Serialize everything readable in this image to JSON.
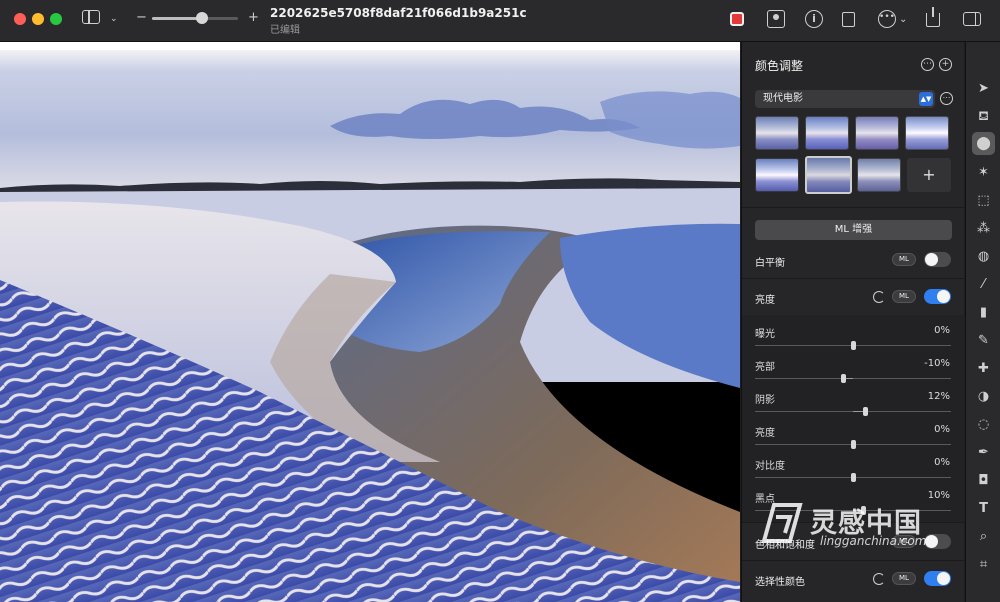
{
  "window": {
    "title": "2202625e5708f8daf21f066d1b9a251c",
    "subtitle": "已编辑",
    "zoom_minus": "−",
    "zoom_plus": "+",
    "zoom_level_fraction": 0.58
  },
  "toolbar_icons": [
    "sidebar-icon",
    "chevron-down-icon",
    "color-badge-icon",
    "portrait-icon",
    "info-icon",
    "rotate-icon",
    "more-icon",
    "share-icon",
    "inspector-icon"
  ],
  "panel": {
    "title": "颜色调整",
    "header_more": "⋯",
    "header_add": "+",
    "preset": {
      "selected": "现代电影",
      "more": "⋯"
    },
    "thumb_add": "+",
    "ml_enhance_label": "ML 增强",
    "white_balance": {
      "label": "白平衡",
      "ml": "ML",
      "enabled": false
    },
    "lightness": {
      "label": "亮度",
      "ml": "ML",
      "enabled": true,
      "sliders": [
        {
          "label": "曝光",
          "value_text": "0%",
          "value": 0
        },
        {
          "label": "亮部",
          "value_text": "-10%",
          "value": -10
        },
        {
          "label": "阴影",
          "value_text": "12%",
          "value": 12
        },
        {
          "label": "亮度",
          "value_text": "0%",
          "value": 0
        },
        {
          "label": "对比度",
          "value_text": "0%",
          "value": 0
        },
        {
          "label": "黑点",
          "value_text": "10%",
          "value": 10
        }
      ]
    },
    "hue_saturation": {
      "label": "色相和饱和度",
      "ml": "ML",
      "enabled": false
    },
    "selective_color": {
      "label": "选择性颜色",
      "ml": "ML",
      "enabled": true
    }
  },
  "tools": [
    "arrow-icon",
    "paint-bucket-icon",
    "color-adjust-icon",
    "magic-star-icon",
    "marquee-icon",
    "magic-wand-icon",
    "brush-select-icon",
    "paintbrush-icon",
    "eraser-icon",
    "pencil-icon",
    "bandage-icon",
    "clone-icon",
    "blur-icon",
    "pen-icon",
    "shapes-icon",
    "text-icon",
    "magnify-icon",
    "crop-icon"
  ],
  "text_tool_glyph": "T",
  "watermark": {
    "cn": "灵感中国",
    "en": "lingganchina.com"
  }
}
